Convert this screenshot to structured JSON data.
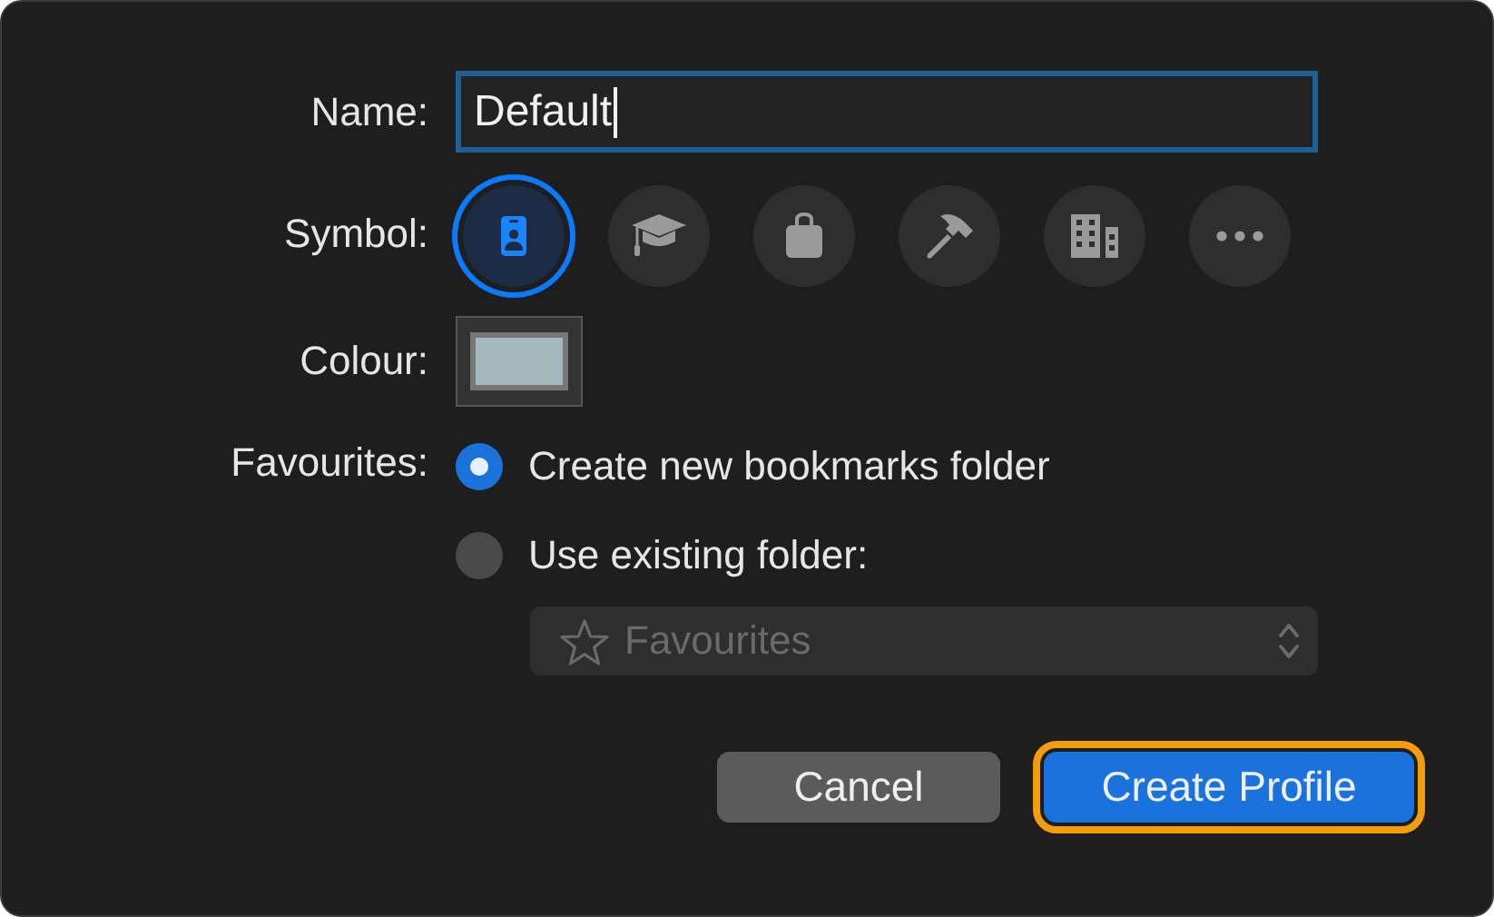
{
  "name": {
    "label": "Name:",
    "value": "Default",
    "focused": true
  },
  "symbol": {
    "label": "Symbol:",
    "items": [
      {
        "kind": "id-card",
        "selected": true
      },
      {
        "kind": "graduation-cap",
        "selected": false
      },
      {
        "kind": "bag",
        "selected": false
      },
      {
        "kind": "hammer",
        "selected": false
      },
      {
        "kind": "building",
        "selected": false
      },
      {
        "kind": "more",
        "selected": false
      }
    ]
  },
  "colour": {
    "label": "Colour:",
    "color": "#a3b9bd"
  },
  "favourites": {
    "label": "Favourites:",
    "options": [
      {
        "label": "Create new bookmarks folder",
        "selected": true
      },
      {
        "label": "Use existing folder:",
        "selected": false
      }
    ],
    "folder_popup": {
      "value": "Favourites",
      "disabled": true
    }
  },
  "buttons": [
    {
      "label": "Cancel",
      "kind": "secondary",
      "highlighted": false
    },
    {
      "label": "Create Profile",
      "kind": "primary",
      "highlighted": true
    }
  ]
}
